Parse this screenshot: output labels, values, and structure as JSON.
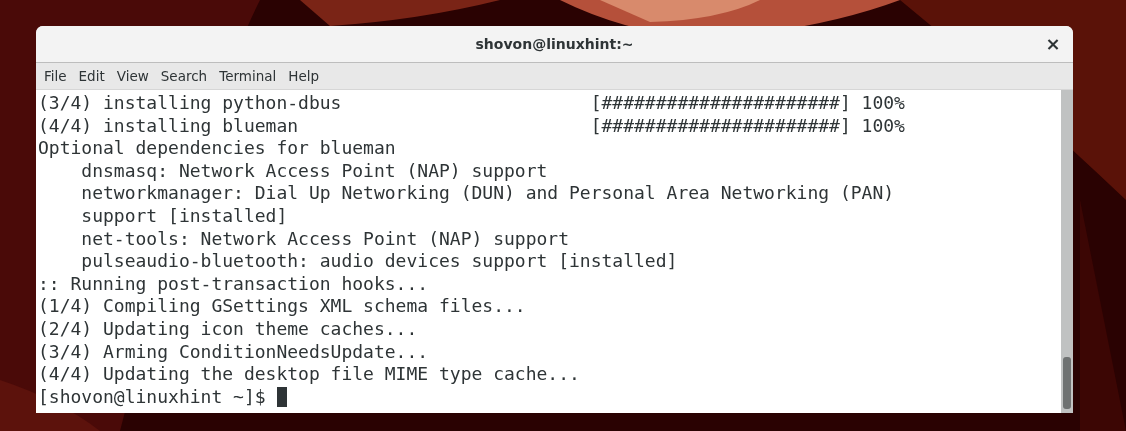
{
  "window": {
    "title": "shovon@linuxhint:~",
    "close": "×"
  },
  "menu": [
    "File",
    "Edit",
    "View",
    "Search",
    "Terminal",
    "Help"
  ],
  "terminal": {
    "lines": [
      "(3/4) installing python-dbus                       [######################] 100%",
      "(4/4) installing blueman                           [######################] 100%",
      "Optional dependencies for blueman",
      "    dnsmasq: Network Access Point (NAP) support",
      "    networkmanager: Dial Up Networking (DUN) and Personal Area Networking (PAN)",
      "    support [installed]",
      "    net-tools: Network Access Point (NAP) support",
      "    pulseaudio-bluetooth: audio devices support [installed]",
      ":: Running post-transaction hooks...",
      "(1/4) Compiling GSettings XML schema files...",
      "(2/4) Updating icon theme caches...",
      "(3/4) Arming ConditionNeedsUpdate...",
      "(4/4) Updating the desktop file MIME type cache..."
    ],
    "prompt": "[shovon@linuxhint ~]$"
  }
}
